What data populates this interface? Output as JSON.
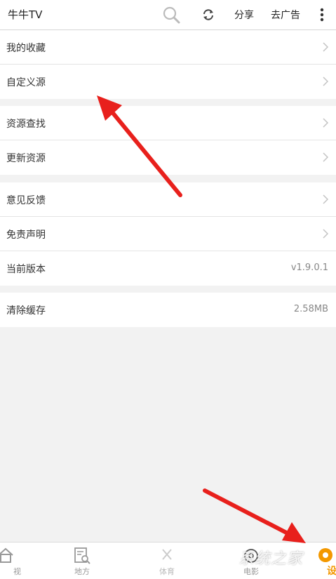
{
  "header": {
    "title": "牛牛TV",
    "search_icon": "search-icon",
    "refresh_icon": "refresh-icon",
    "share_label": "分享",
    "remove_ads_label": "去广告",
    "more_icon": "more-vertical-icon"
  },
  "menu": {
    "group1": [
      {
        "label": "我的收藏"
      },
      {
        "label": "自定义源"
      }
    ],
    "group2": [
      {
        "label": "资源查找"
      },
      {
        "label": "更新资源"
      }
    ],
    "group3": [
      {
        "label": "意见反馈"
      },
      {
        "label": "免责声明"
      },
      {
        "label": "当前版本",
        "value": "v1.9.0.1"
      }
    ],
    "group4": [
      {
        "label": "清除缓存",
        "value": "2.58MB"
      }
    ]
  },
  "tabbar": {
    "tabs": [
      {
        "label": "视",
        "icon": "home-icon"
      },
      {
        "label": "地方",
        "icon": "local-search-icon"
      },
      {
        "label": "体育",
        "icon": "sports-icon"
      },
      {
        "label": "电影",
        "icon": "movie-icon"
      },
      {
        "label": "设",
        "icon": "settings-icon"
      }
    ]
  },
  "watermark": {
    "text": "系统之家"
  },
  "colors": {
    "accent": "#f39800",
    "arrow": "#e8201c",
    "background": "#f2f2f2"
  }
}
